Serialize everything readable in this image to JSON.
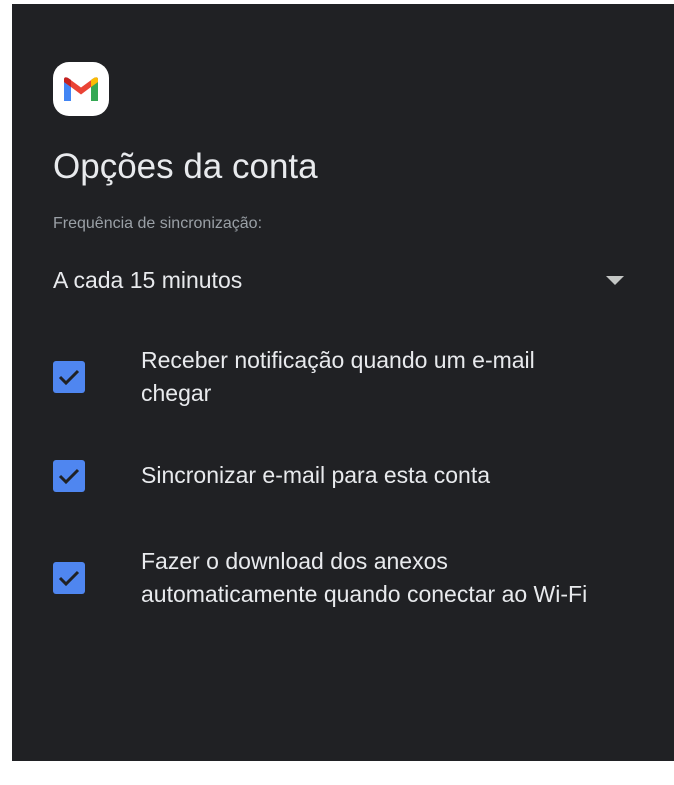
{
  "header": {
    "title": "Opções da conta",
    "logo_icon": "gmail-logo-icon"
  },
  "sync": {
    "label": "Frequência de sincronização:",
    "value": "A cada 15 minutos",
    "dropdown_icon": "dropdown-arrow-icon"
  },
  "options": [
    {
      "label": "Receber notificação quando um e-mail chegar",
      "checked": true
    },
    {
      "label": "Sincronizar e-mail para esta conta",
      "checked": true
    },
    {
      "label": "Fazer o download dos anexos automaticamente quando conectar ao Wi-Fi",
      "checked": true
    }
  ],
  "colors": {
    "background": "#202124",
    "text": "#e8eaed",
    "secondary_text": "#9aa0a6",
    "checkbox": "#4f86f0"
  }
}
